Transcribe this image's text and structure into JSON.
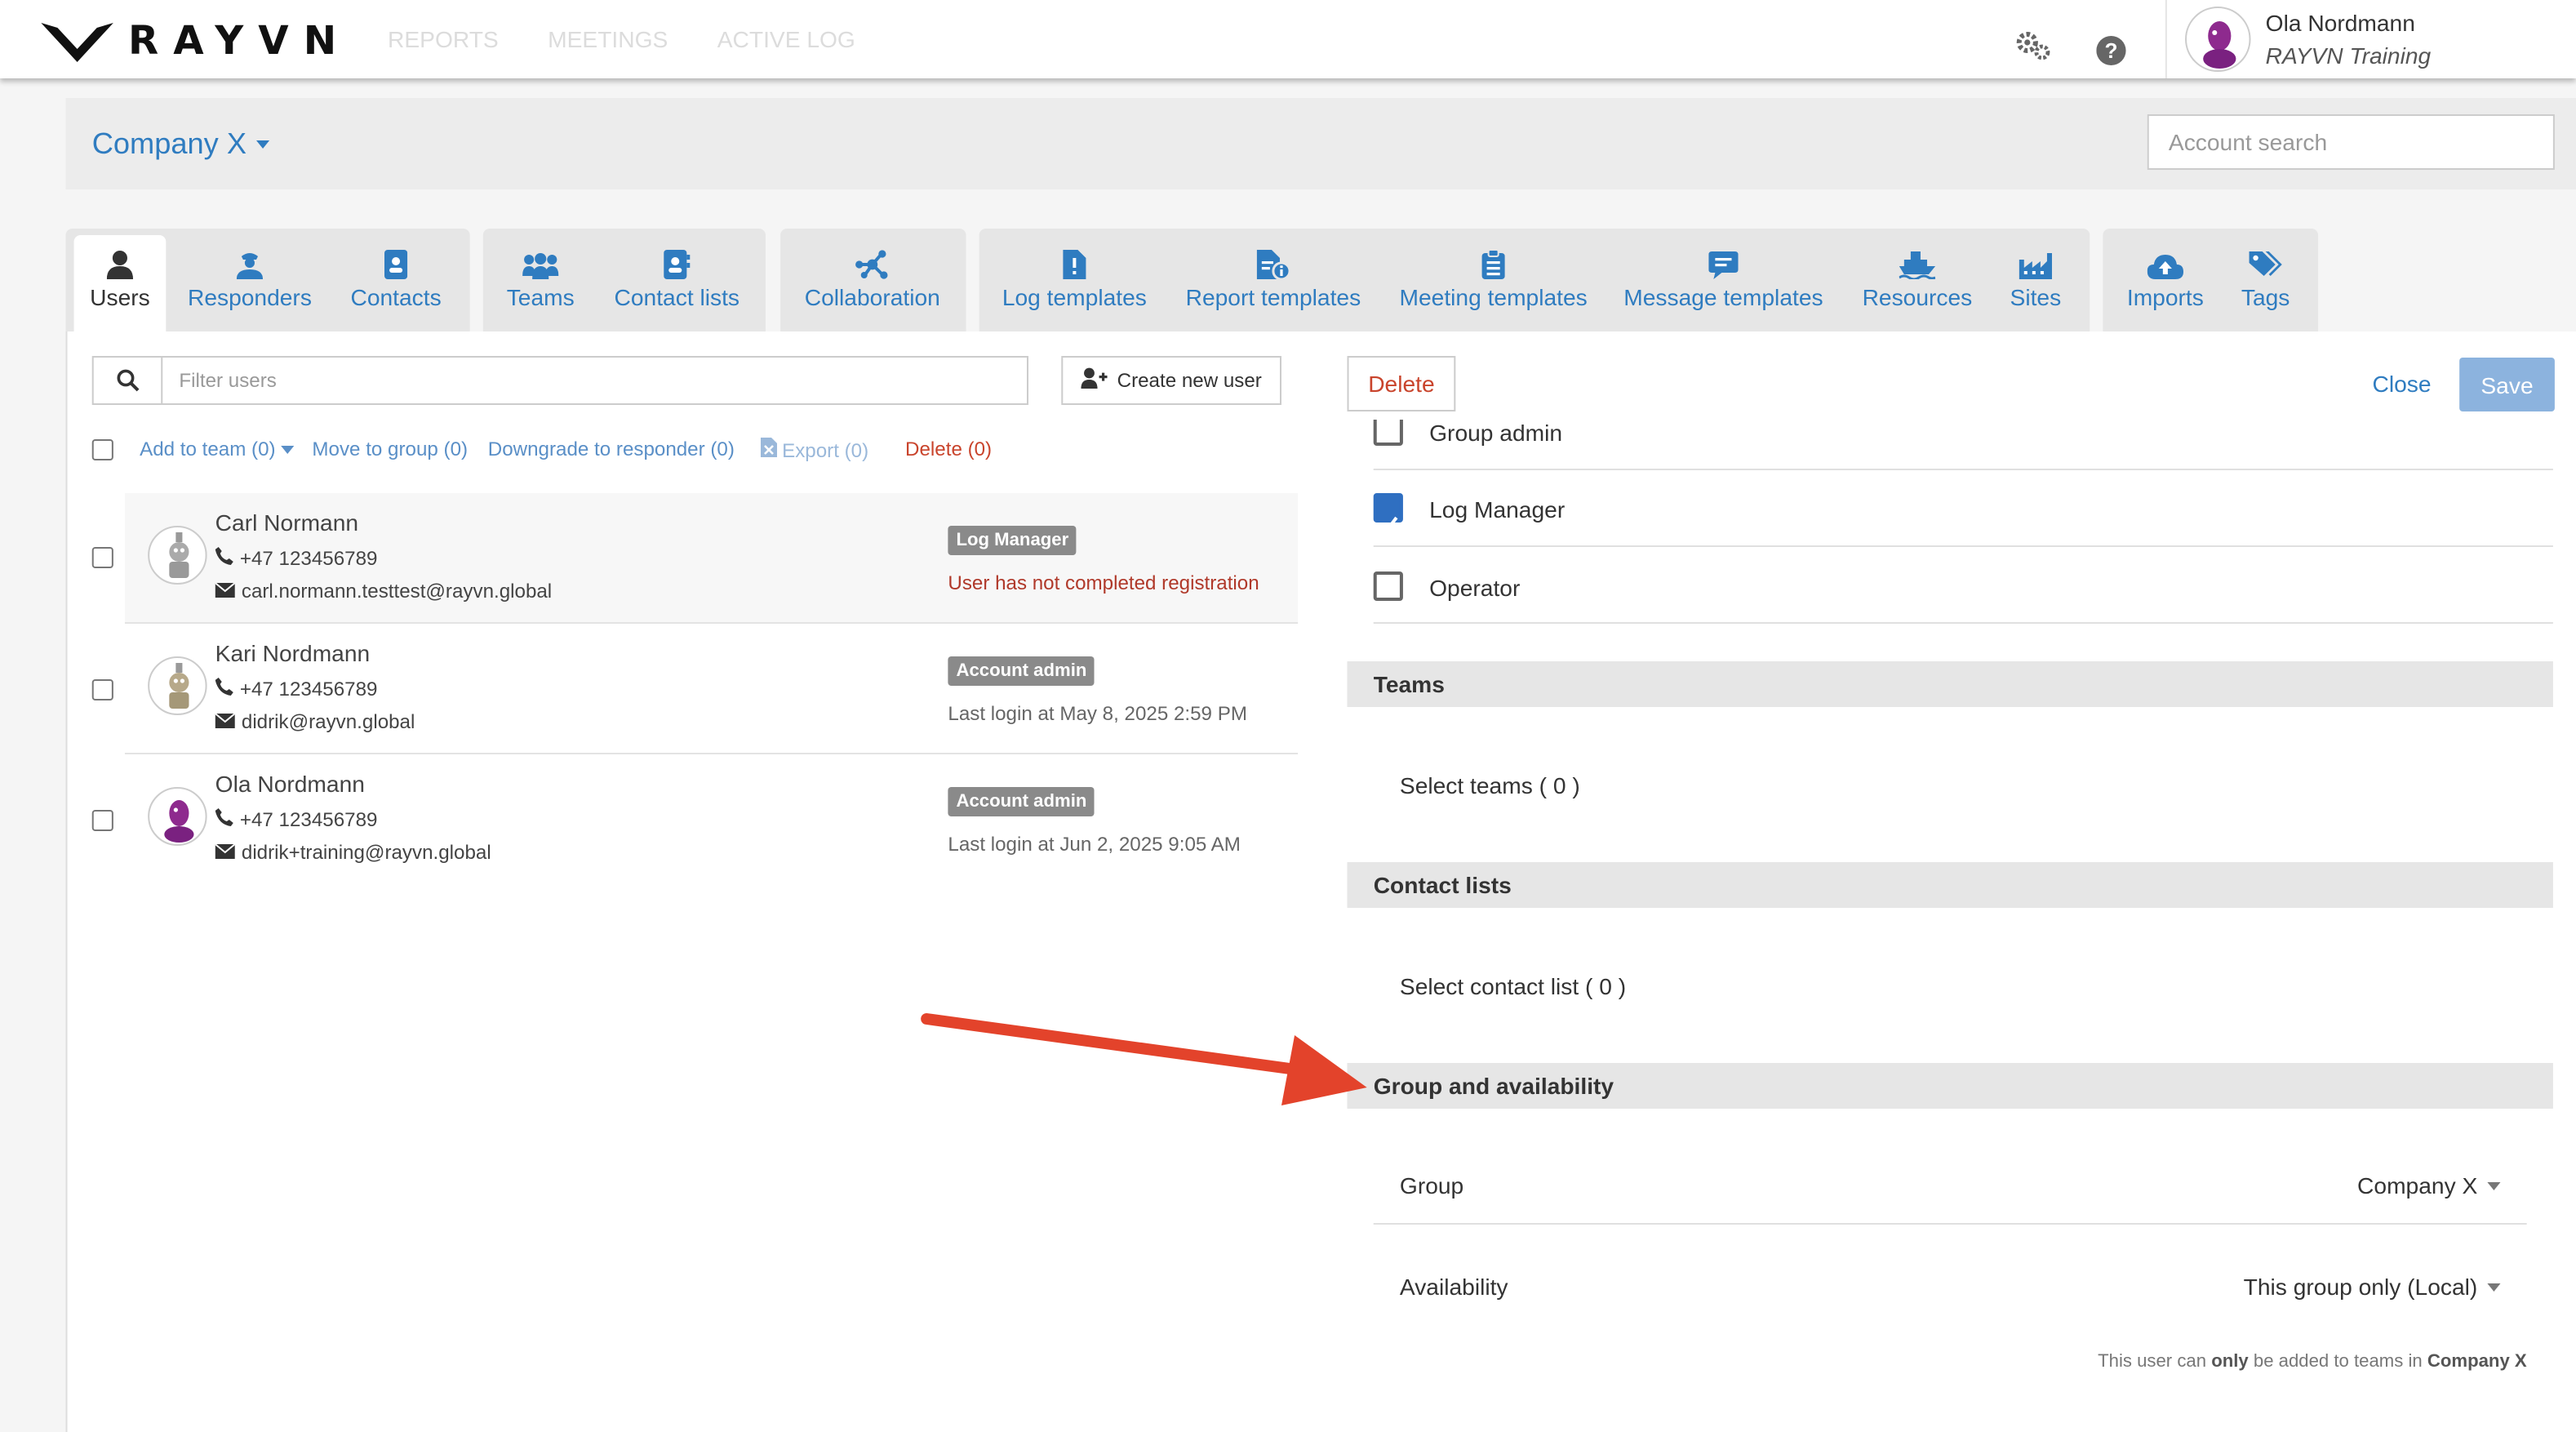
{
  "header": {
    "logo_text": "RAYVN",
    "nav": [
      "REPORTS",
      "MEETINGS",
      "ACTIVE LOG"
    ],
    "settings_icon": "gears-icon",
    "help_icon": "help-circle-icon",
    "user": {
      "name": "Ola Nordmann",
      "org": "RAYVN Training"
    }
  },
  "company": {
    "name": "Company X",
    "search_placeholder": "Account search"
  },
  "tabs": [
    {
      "label": "Users",
      "icon": "user-icon",
      "active": true
    },
    {
      "label": "Responders",
      "icon": "responder-icon"
    },
    {
      "label": "Contacts",
      "icon": "contact-card-icon"
    },
    {
      "label": "Teams",
      "icon": "users-group-icon"
    },
    {
      "label": "Contact lists",
      "icon": "address-book-icon"
    },
    {
      "label": "Collaboration",
      "icon": "network-icon"
    },
    {
      "label": "Log templates",
      "icon": "file-alert-icon"
    },
    {
      "label": "Report templates",
      "icon": "file-info-icon"
    },
    {
      "label": "Meeting templates",
      "icon": "clipboard-list-icon"
    },
    {
      "label": "Message templates",
      "icon": "message-icon"
    },
    {
      "label": "Resources",
      "icon": "ship-icon"
    },
    {
      "label": "Sites",
      "icon": "factory-icon"
    },
    {
      "label": "Imports",
      "icon": "cloud-upload-icon"
    },
    {
      "label": "Tags",
      "icon": "tags-icon"
    }
  ],
  "users_panel": {
    "filter_placeholder": "Filter users",
    "create_button": "Create new user",
    "bulk": {
      "add_to_team": "Add to team (0)",
      "move_to_group": "Move to group (0)",
      "downgrade": "Downgrade to responder (0)",
      "export": "Export (0)",
      "delete": "Delete (0)"
    },
    "users": [
      {
        "name": "Carl Normann",
        "phone": "+47 123456789",
        "email": "carl.normann.testtest@rayvn.global",
        "role": "Log Manager",
        "status": "User has not completed registration",
        "selected": true
      },
      {
        "name": "Kari Nordmann",
        "phone": "+47 123456789",
        "email": "didrik@rayvn.global",
        "role": "Account admin",
        "status": "Last login at May 8, 2025 2:59 PM"
      },
      {
        "name": "Ola Nordmann",
        "phone": "+47 123456789",
        "email": "didrik+training@rayvn.global",
        "role": "Account admin",
        "status": "Last login at Jun 2, 2025 9:05 AM"
      }
    ]
  },
  "detail_panel": {
    "delete_button": "Delete",
    "close_link": "Close",
    "save_button": "Save",
    "roles": [
      {
        "label": "Group admin",
        "checked": false
      },
      {
        "label": "Log Manager",
        "checked": true
      },
      {
        "label": "Operator",
        "checked": false
      }
    ],
    "teams": {
      "heading": "Teams",
      "select": "Select teams ( 0 )"
    },
    "contact_lists": {
      "heading": "Contact lists",
      "select": "Select contact list ( 0 )"
    },
    "group_availability": {
      "heading": "Group and availability",
      "group_label": "Group",
      "group_value": "Company X",
      "availability_label": "Availability",
      "availability_value": "This group only (Local)",
      "note_prefix": "This user can",
      "note_strong": "only",
      "note_middle": "be added to teams in",
      "note_company": "Company X"
    }
  },
  "colors": {
    "link": "#2f7cc0",
    "danger": "#c9442c",
    "arrow": "#e3432b",
    "save_disabled": "#8cb3de",
    "checkbox": "#2f6fc1"
  }
}
